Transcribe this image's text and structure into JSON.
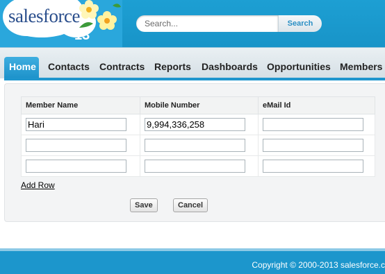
{
  "header": {
    "logo_text": "salesforce",
    "logo_version": "13",
    "search": {
      "placeholder": "Search...",
      "button_label": "Search"
    }
  },
  "tabs": [
    {
      "label": "Home",
      "active": true
    },
    {
      "label": "Contacts"
    },
    {
      "label": "Contracts"
    },
    {
      "label": "Reports"
    },
    {
      "label": "Dashboards"
    },
    {
      "label": "Opportunities"
    },
    {
      "label": "Members"
    }
  ],
  "table": {
    "columns": [
      "Member Name",
      "Mobile Number",
      "eMail Id"
    ],
    "rows": [
      [
        "Hari",
        "9,994,336,258",
        ""
      ],
      [
        "",
        "",
        ""
      ],
      [
        "",
        "",
        ""
      ]
    ]
  },
  "add_row_label": "Add Row",
  "buttons": {
    "save": "Save",
    "cancel": "Cancel"
  },
  "footer": {
    "copyright": "Copyright © 2000-2013 salesforce.c"
  },
  "colors": {
    "brand_blue": "#1c96cc",
    "active_tab": "#2ba3da"
  }
}
